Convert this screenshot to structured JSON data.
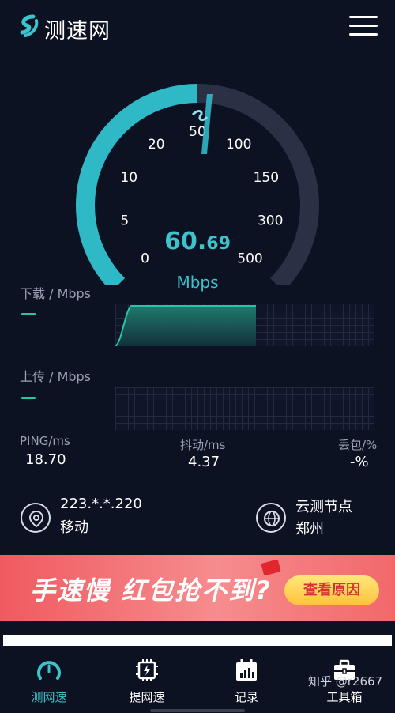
{
  "header": {
    "title": "测速网"
  },
  "gauge": {
    "speed_int": "60.",
    "speed_dec": "69",
    "unit": "Mbps",
    "scale": [
      "0",
      "5",
      "10",
      "20",
      "50",
      "100",
      "150",
      "300",
      "500"
    ],
    "progress_fraction": 0.5
  },
  "download": {
    "label": "下载 / Mbps",
    "value": "—"
  },
  "upload": {
    "label": "上传 / Mbps",
    "value": "—"
  },
  "stats": {
    "ping_label": "PING/ms",
    "ping_value": "18.70",
    "jitter_label": "抖动/ms",
    "jitter_value": "4.37",
    "loss_label": "丢包/%",
    "loss_value": "-%"
  },
  "info": {
    "ip": "223.*.*.220",
    "isp": "移动",
    "node_label": "云测节点",
    "node_city": "郑州"
  },
  "banner": {
    "text": "手速慢 红包抢不到?",
    "button": "查看原因"
  },
  "tabs": [
    {
      "label": "测网速",
      "icon": "speedometer-icon"
    },
    {
      "label": "提网速",
      "icon": "chip-icon"
    },
    {
      "label": "记录",
      "icon": "calendar-chart-icon"
    },
    {
      "label": "工具箱",
      "icon": "toolbox-icon"
    }
  ],
  "watermark": "知乎 @r2667",
  "colors": {
    "accent": "#3cc3cc",
    "graph": "#2ec1a8",
    "background": "#0d1222",
    "banner": "#f05a5f"
  }
}
